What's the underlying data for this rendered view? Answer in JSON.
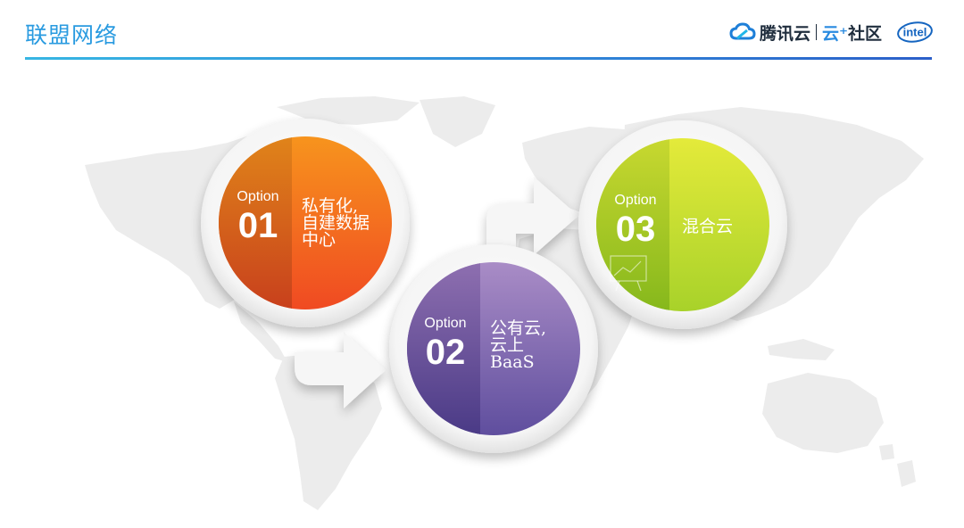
{
  "page": {
    "title": "联盟网络"
  },
  "logos": {
    "tencent": "腾讯云",
    "community": "社区",
    "intel": "intel"
  },
  "options": [
    {
      "prefix": "Option",
      "number": "01",
      "text": "私有化,\n自建数据\n中心"
    },
    {
      "prefix": "Option",
      "number": "02",
      "text": "公有云,\n云上\nBaaS"
    },
    {
      "prefix": "Option",
      "number": "03",
      "text": "混合云"
    }
  ],
  "colors": {
    "accent": "#2a9be0",
    "option1": "#f07a1c",
    "option2": "#8a6ab2",
    "option3": "#b8d92e"
  }
}
